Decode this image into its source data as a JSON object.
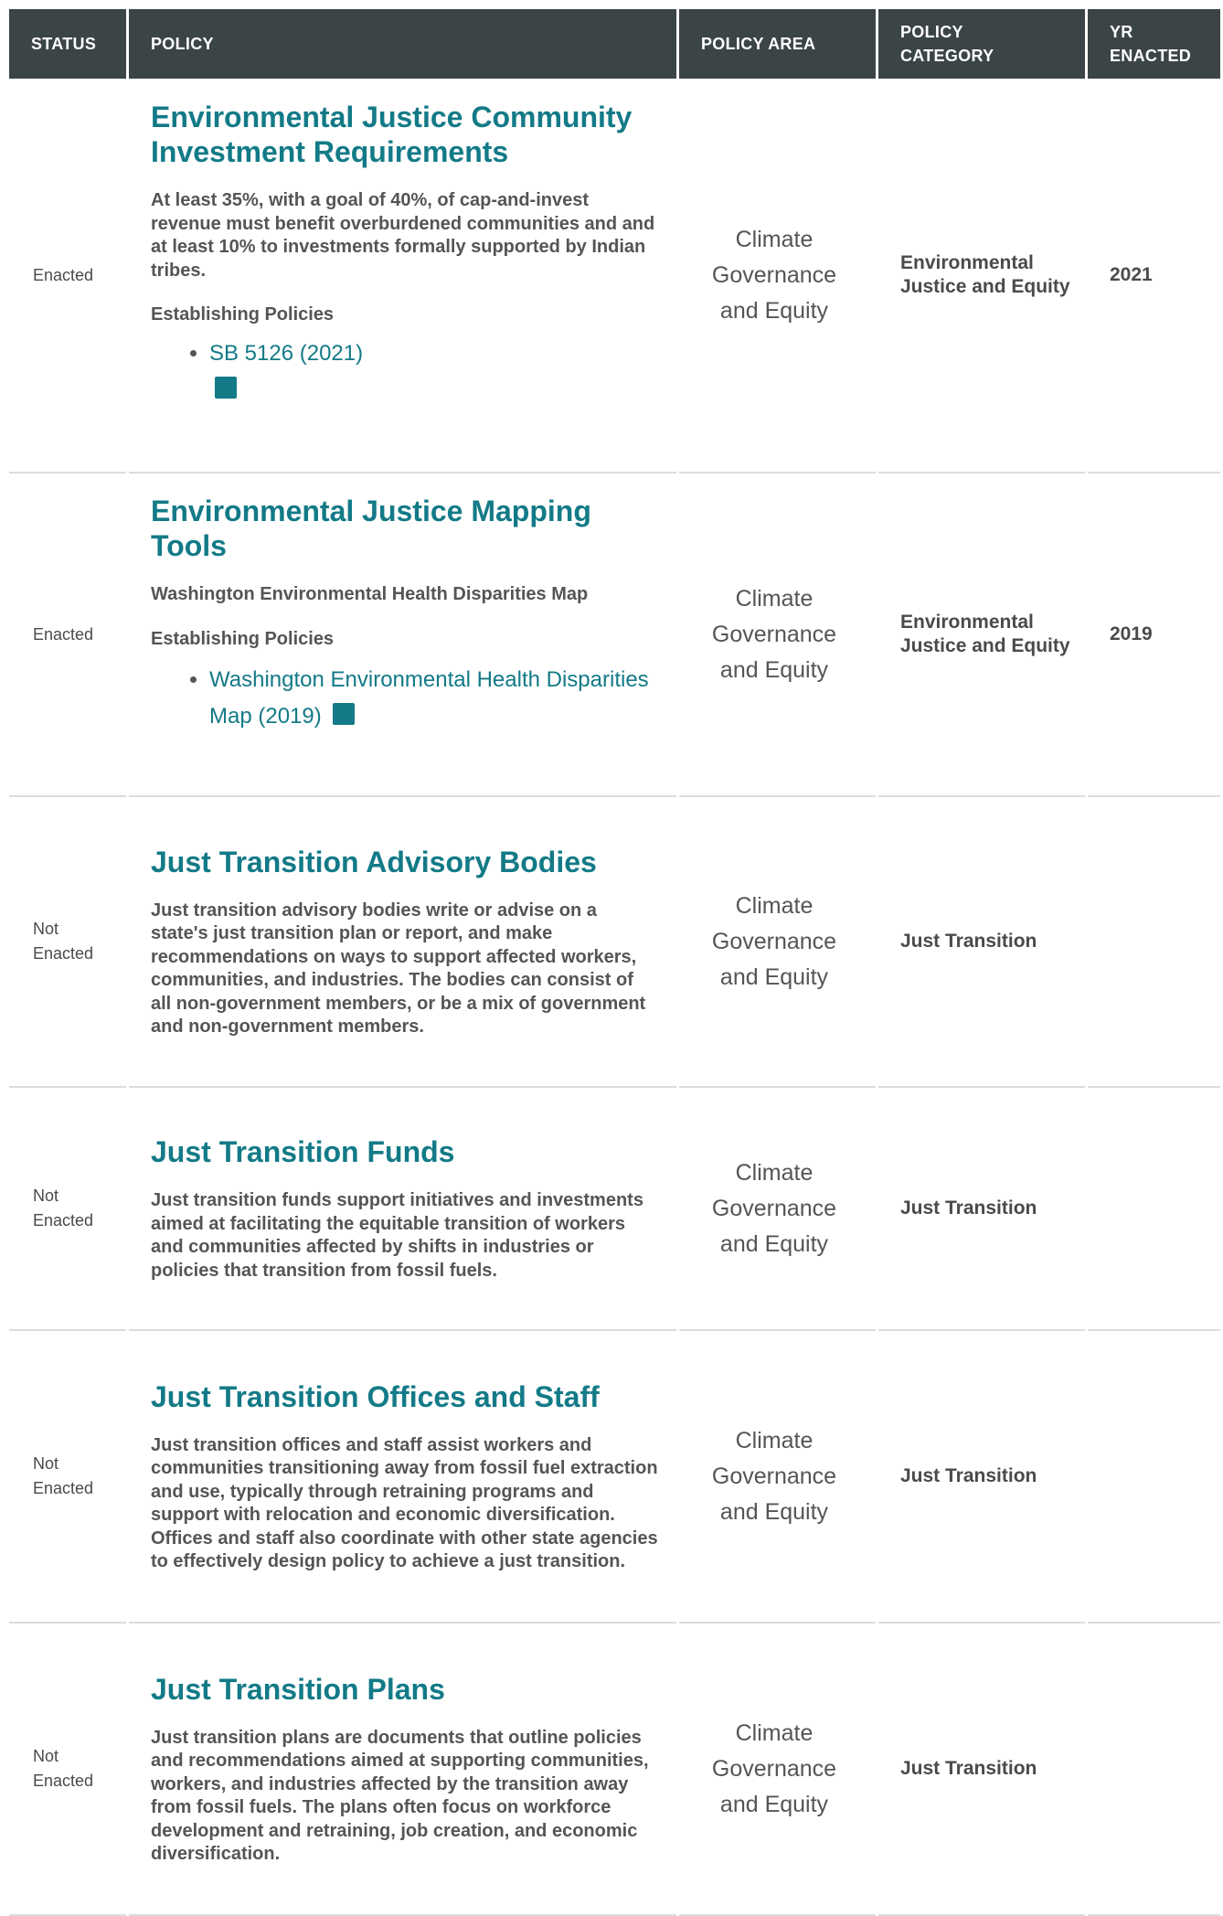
{
  "header": {
    "status": "STATUS",
    "policy": "POLICY",
    "area": "POLICY AREA",
    "category_line1": "POLICY",
    "category_line2": "CATEGORY",
    "year_line1": "YR",
    "year_line2": "ENACTED"
  },
  "rows": [
    {
      "status_line1": "Enacted",
      "status_line2": "",
      "title": "Environmental Justice Community Investment Requirements",
      "description": "At least 35%, with a goal of 40%, of cap-and-invest revenue must benefit overburdened communities and and at least 10% to investments formally supported by Indian tribes.",
      "establishing_label": "Establishing Policies",
      "link": "SB 5126 (2021)",
      "area": "Climate Governance and Equity",
      "category": "Environmental Justice and Equity",
      "year": "2021"
    },
    {
      "status_line1": "Enacted",
      "status_line2": "",
      "title": "Environmental Justice Mapping Tools",
      "description": "Washington Environmental Health Disparities Map",
      "establishing_label": "Establishing Policies",
      "link": "Washington Environmental Health Disparities Map (2019)",
      "area": "Climate Governance and Equity",
      "category": "Environmental Justice and Equity",
      "year": "2019"
    },
    {
      "status_line1": "Not",
      "status_line2": "Enacted",
      "title": "Just Transition Advisory Bodies",
      "description": "Just transition advisory bodies write or advise on a state's just transition plan or report, and make recommendations on ways to support affected workers, communities, and industries. The bodies can consist of all non-government members, or be a mix of government and non-government members.",
      "area": "Climate Governance and Equity",
      "category": "Just Transition",
      "year": ""
    },
    {
      "status_line1": "Not",
      "status_line2": "Enacted",
      "title": "Just Transition Funds",
      "description": "Just transition funds support initiatives and investments aimed at facilitating the equitable transition of workers and communities affected by shifts in industries or policies that transition from fossil fuels.",
      "area": "Climate Governance and Equity",
      "category": "Just Transition",
      "year": ""
    },
    {
      "status_line1": "Not",
      "status_line2": "Enacted",
      "title": "Just Transition Offices and Staff",
      "description": "Just transition offices and staff assist workers and communities transitioning away from fossil fuel extraction and use, typically through retraining programs and support with relocation and economic diversification. Offices and staff also coordinate with other state agencies to effectively design policy to achieve a just transition.",
      "area": "Climate Governance and Equity",
      "category": "Just Transition",
      "year": ""
    },
    {
      "status_line1": "Not",
      "status_line2": "Enacted",
      "title": "Just Transition Plans",
      "description": "Just transition plans are documents that outline policies and recommendations aimed at supporting communities, workers, and industries affected by the transition away from fossil fuels. The plans often focus on workforce development and retraining, job creation, and economic diversification.",
      "area": "Climate Governance and Equity",
      "category": "Just Transition",
      "year": ""
    }
  ]
}
